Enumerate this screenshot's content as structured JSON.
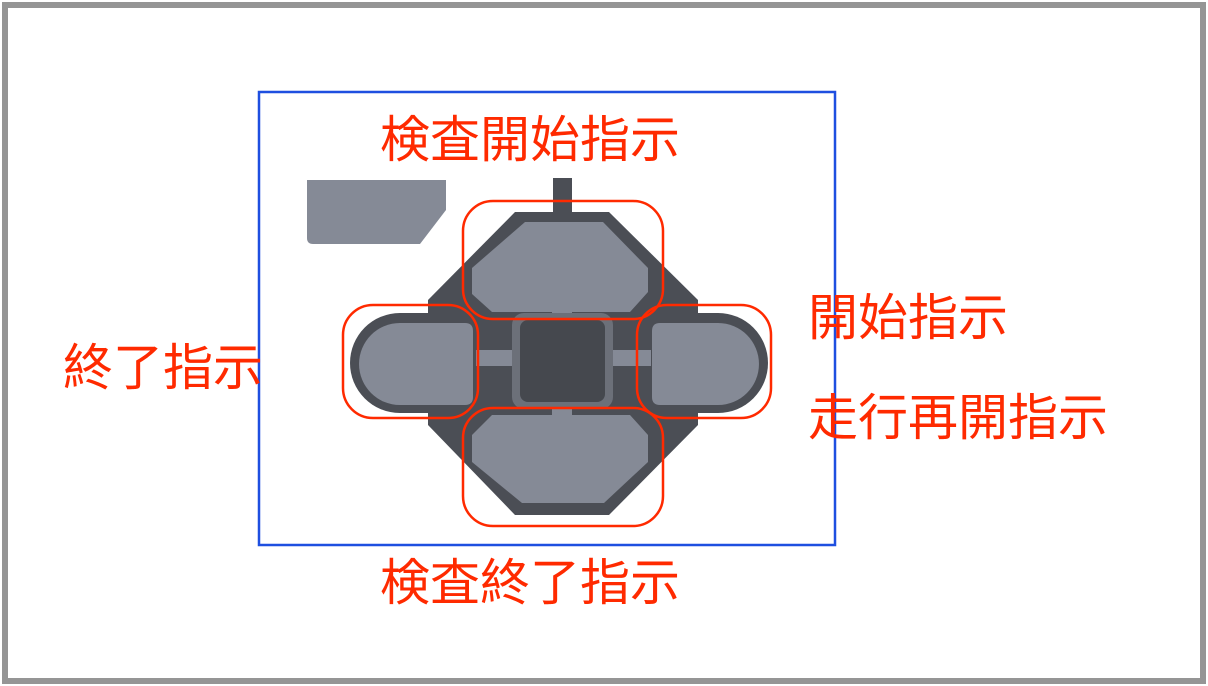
{
  "labels": {
    "top": "検査開始指示",
    "left": "終了指示",
    "right_1": "開始指示",
    "right_2": "走行再開指示",
    "bottom": "検査終了指示"
  },
  "colors": {
    "annotation": "#ff2a00",
    "region_box": "#1e4fe0",
    "outer_frame": "#959595",
    "button_face": "#858a96",
    "button_dark": "#4b4e55",
    "center_key": "#45484e"
  }
}
